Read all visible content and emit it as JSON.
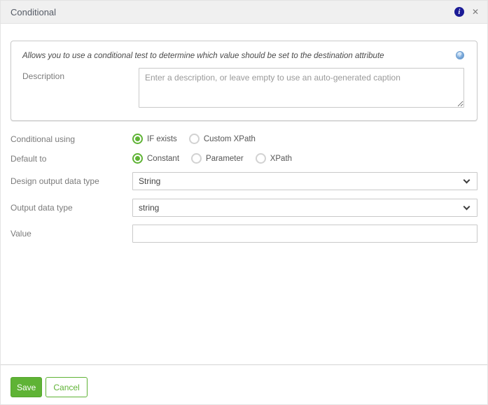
{
  "header": {
    "title": "Conditional"
  },
  "icons": {
    "info": "i",
    "close": "✕",
    "help": "?"
  },
  "intro": {
    "text": "Allows you to use a conditional test to determine which value should be set to the destination attribute"
  },
  "description": {
    "label": "Description",
    "placeholder": "Enter a description, or leave empty to use an auto-generated caption",
    "value": ""
  },
  "conditional_using": {
    "label": "Conditional using",
    "options": [
      {
        "label": "IF exists",
        "selected": true
      },
      {
        "label": "Custom XPath",
        "selected": false
      }
    ]
  },
  "default_to": {
    "label": "Default to",
    "options": [
      {
        "label": "Constant",
        "selected": true
      },
      {
        "label": "Parameter",
        "selected": false
      },
      {
        "label": "XPath",
        "selected": false
      }
    ]
  },
  "design_output_data_type": {
    "label": "Design output data type",
    "value": "String"
  },
  "output_data_type": {
    "label": "Output data type",
    "value": "string"
  },
  "value_field": {
    "label": "Value",
    "value": ""
  },
  "footer": {
    "save": "Save",
    "cancel": "Cancel"
  },
  "colors": {
    "accent_green": "#5fb335",
    "info_blue": "#1b1b96",
    "help_blue": "#4d86c6",
    "header_bg": "#f0f0f0"
  }
}
